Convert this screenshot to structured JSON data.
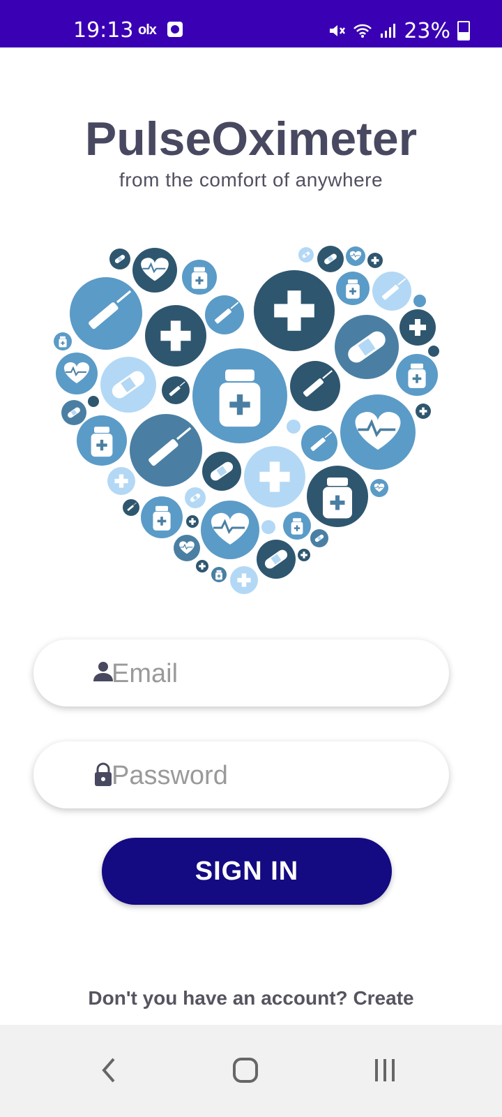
{
  "status": {
    "time": "19:13",
    "carrier_icon": "olx",
    "battery_percent": "23%"
  },
  "app": {
    "title": "PulseOximeter",
    "subtitle": "from the comfort of anywhere"
  },
  "form": {
    "email_placeholder": "Email",
    "password_placeholder": "Password",
    "signin_label": "SIGN IN"
  },
  "signup": {
    "prompt": "Don't you have an account?",
    "link": "Create"
  },
  "colors": {
    "status_bar": "#3a00b4",
    "primary_button": "#140a82",
    "title": "#484860",
    "bubble_dark": "#2f566f",
    "bubble_mid": "#4a7fa3",
    "bubble_blue": "#5b9bc7",
    "bubble_light": "#b3d8f5"
  },
  "icons": {
    "email": "person-icon",
    "password": "lock-icon",
    "back": "back-icon",
    "home": "home-icon",
    "recents": "recents-icon"
  }
}
